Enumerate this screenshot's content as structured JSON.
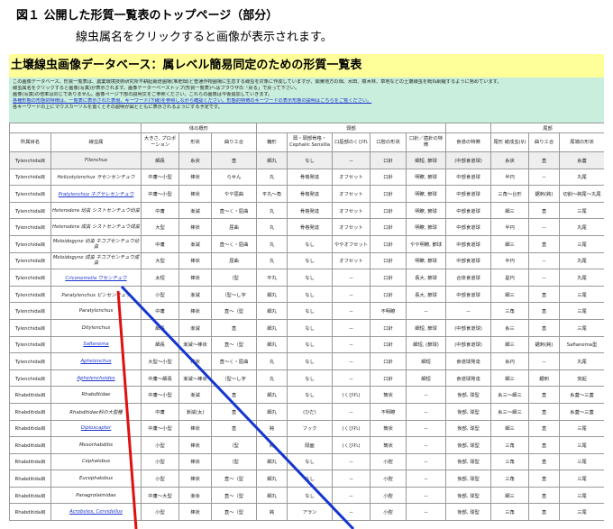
{
  "caption": "図１ 公開した形質一覧表のトップページ（部分）",
  "subcaption": "線虫属名をクリックすると画像が表示されます。",
  "banner": "土壌線虫画像データベース：属レベル簡易同定のための形質一覧表",
  "intro": [
    "この画像データベース、形質一覧表は、農業環境技術研究所不耕起栽培圃場(堆肥畑)と普通作物圃場に生息する線虫を対象に作成していますが、関東地方の畑、水田、樹木林、草地などの土壌線虫を概ね網羅するように努めています。",
    "線虫属名をクリックすると画像(写真)が表示されます。画像データーベーストップ(形質一覧表)へはブラウザの「戻る」で戻って下さい。",
    "画像(写真)の倍率は同じでありません。画像ページ下部の説明文をご参照ください。これらの画像は今後追加していきます。",
    "各種形態の形態的特徴は、一覧表に表示された表現、キーワード(下線)を参照しながら確認ください。形態的特徴のキーワードの表示形態の説明はこちらをご覧ください。",
    "各キーワードの上にマウスカーソルを置くとその説明が図とともに表示されるようにする予定です。"
  ],
  "header": {
    "g1": "",
    "g2": "体の概形",
    "g3": "頭部",
    "g4": "尾部",
    "cols": [
      "所属目名",
      "線虫属",
      "大きさ, プロポーション",
      "形状",
      "曲りエ合",
      "輪形",
      "頭・頭部骨格・Cephalic Sensilla",
      "口唇部のくびれ",
      "口腔の形状",
      "口針／歯針の特徴",
      "食道の特徴",
      "尾形 雌成虫(♀)",
      "曲りエ合",
      "尾端の形状"
    ]
  },
  "rows": [
    {
      "order": "Tylenchida目",
      "genus": "Filenchus",
      "c": [
        "細長",
        "糸状",
        "直",
        "細丸",
        "なし",
        "－",
        "口針",
        "細短, 節球",
        "(中部食道球)",
        "糸状",
        "直",
        "糸蓋"
      ]
    },
    {
      "order": "Tylenchida目",
      "genus": "Helicotylenchus ラセンセンチュウ",
      "c": [
        "中庸～小型",
        "棒状",
        "らせん",
        "丸",
        "骨格発達",
        "オフセット",
        "口針",
        "明瞭, 節球",
        "中部食道球",
        "半円",
        "－",
        "丸尾"
      ]
    },
    {
      "order": "Tylenchida目",
      "genus": "Pratylenchus ネグサレセンチュウ",
      "link": true,
      "c": [
        "中庸～小型",
        "棒状",
        "やや屈曲",
        "平丸～角",
        "骨格発達",
        "オフセット",
        "口針",
        "明瞭, 節球",
        "中部食道球",
        "三角～台形",
        "鋸刺(鈍)",
        "切削～鈍尾～丸尾"
      ]
    },
    {
      "order": "Tylenchida目",
      "genus": "Heterodera 幼虫 シストセンチュウ幼虫",
      "two": true,
      "c": [
        "中庸",
        "漸減",
        "直～く・屈曲",
        "丸",
        "骨格発達",
        "オフセット",
        "口針",
        "明瞭, 節球",
        "中部食道球",
        "細三",
        "直",
        "三尾"
      ]
    },
    {
      "order": "Tylenchida目",
      "genus": "Heterodera 成虫 シストセンチュウ成虫",
      "two": true,
      "c": [
        "大型",
        "棒状",
        "屈曲",
        "丸",
        "骨格発達",
        "オフセット",
        "口針",
        "明瞭, 節球",
        "中部食道球",
        "半円",
        "－",
        "丸尾"
      ]
    },
    {
      "order": "Tylenchida目",
      "genus": "Meloidogyne 幼虫 ネコブセンチュウ幼虫",
      "two": true,
      "c": [
        "中庸",
        "漸減",
        "直～く・屈曲",
        "丸",
        "なし",
        "ややオフセット",
        "口針",
        "やや明瞭, 節球",
        "中部食道球",
        "細三",
        "直",
        "三尾"
      ]
    },
    {
      "order": "Tylenchida目",
      "genus": "Meloidogyne 成虫 ネコブセンチュウ成虫",
      "two": true,
      "c": [
        "大型",
        "棒状",
        "屈曲",
        "丸",
        "なし",
        "オフセット",
        "口針",
        "明瞭, 節球",
        "中部食道球",
        "半円",
        "－",
        "丸尾"
      ]
    },
    {
      "order": "Tylenchida目",
      "genus": "Criconemella ワセンチュウ",
      "link": true,
      "c": [
        "太短",
        "棒状",
        "（型",
        "平丸",
        "なし",
        "－",
        "口針",
        "長大, 節球",
        "合体食道球",
        "星円",
        "－",
        "丸尾"
      ]
    },
    {
      "order": "Tylenchida目",
      "genus": "Paratylenchus ピンセンチュウ",
      "c": [
        "小型",
        "漸減",
        "（型～し字",
        "細丸",
        "なし",
        "－",
        "口針",
        "長大, 節球",
        "中部食道球",
        "細三",
        "直",
        "三尾"
      ]
    },
    {
      "order": "Tylenchida目",
      "genus": "Paratylenchus",
      "c": [
        "中庸",
        "棒状",
        "直～（型",
        "細丸",
        "なし",
        "－",
        "不明瞭",
        "－",
        "－",
        "三角",
        "直",
        "三尾"
      ]
    },
    {
      "order": "Tylenchida目",
      "genus": "Ditylenchus",
      "c": [
        "細長",
        "漸減",
        "直",
        "細丸",
        "なし",
        "－",
        "口針",
        "細短, 節球",
        "(中部食道球)",
        "糸三",
        "直",
        "三尾"
      ]
    },
    {
      "order": "Tylenchida目",
      "genus": "Safianema",
      "link": true,
      "c": [
        "細長",
        "漸減～棒状",
        "直～（型",
        "細丸",
        "なし",
        "－",
        "口針",
        "細短, (節球)",
        "(中部食道球)",
        "細三",
        "鋸刺(鈍)",
        "Safianema型"
      ]
    },
    {
      "order": "Tylenchida目",
      "genus": "Aphelenchus",
      "link": true,
      "c": [
        "大型～小型",
        "棒状",
        "直～く・屈曲",
        "丸",
        "なし",
        "－",
        "口針",
        "細短",
        "食道球発達",
        "糸円",
        "－",
        "丸尾"
      ]
    },
    {
      "order": "Tylenchida目",
      "genus": "Aphelenchoides",
      "link": true,
      "c": [
        "中庸～細長",
        "漸減～棒状",
        "（型～し字",
        "丸",
        "なし",
        "－",
        "口針",
        "細短",
        "食道球発達",
        "細三",
        "鋸刺",
        "突起"
      ]
    },
    {
      "order": "Rhabditida目",
      "genus": "Rhabditidae",
      "c": [
        "中庸～小型",
        "漸減",
        "直",
        "細丸",
        "なし",
        "(くびれ)",
        "筒状",
        "－",
        "後部, 球型",
        "糸三～細三",
        "直",
        "糸蓋～三蓋"
      ]
    },
    {
      "order": "Rhabditida目",
      "genus": "Rhabditidae科の大型種",
      "c": [
        "中庸",
        "漸減(太)",
        "直",
        "細丸",
        "(ひだ)",
        "－",
        "不明瞭",
        "－",
        "後部, 球型",
        "糸三～細三",
        "直",
        "糸蓋～三蓋"
      ]
    },
    {
      "order": "Rhabditida目",
      "genus": "Diploscapter",
      "link": true,
      "c": [
        "中庸～小型",
        "棒状",
        "直",
        "鈍",
        "フック",
        "(くびれ)",
        "筒状",
        "－",
        "後部, 球型",
        "細三",
        "直",
        "三尾"
      ]
    },
    {
      "order": "Rhabditida目",
      "genus": "Mesorhabditis",
      "c": [
        "小型",
        "棒状",
        "（型",
        "鈍",
        "隔面",
        "(くびれ)",
        "筒状",
        "－",
        "後部, 球型",
        "三角",
        "直",
        "三尾"
      ]
    },
    {
      "order": "Rhabditida目",
      "genus": "Cephalobus",
      "c": [
        "小型",
        "棒状",
        "（型",
        "細丸",
        "なし",
        "－",
        "小腔",
        "－",
        "後部, 球型",
        "三角",
        "直",
        "三尾"
      ]
    },
    {
      "order": "Rhabditida目",
      "genus": "Eucephalobus",
      "c": [
        "小型",
        "棒状",
        "直～（型",
        "細丸",
        "なし",
        "－",
        "小腔",
        "－",
        "後部, 球型",
        "三角",
        "直",
        "三尾"
      ]
    },
    {
      "order": "Rhabditida目",
      "genus": "Panagrolaimidae",
      "c": [
        "中庸～大型",
        "漸余",
        "直～（型",
        "細丸",
        "なし",
        "－",
        "小腔",
        "－",
        "後部, 球型",
        "細三",
        "直",
        "三尾"
      ]
    },
    {
      "order": "Rhabditida目",
      "genus": "Acrobeles, Cervidellus",
      "link": true,
      "c": [
        "小型",
        "棒状",
        "直～（型",
        "鈍",
        "アラン",
        "－",
        "小腔",
        "－",
        "後部, 球型",
        "三角",
        "直",
        "三尾"
      ]
    }
  ],
  "pointer_colors": {
    "red": "#e01010",
    "blue": "#1535d0"
  }
}
